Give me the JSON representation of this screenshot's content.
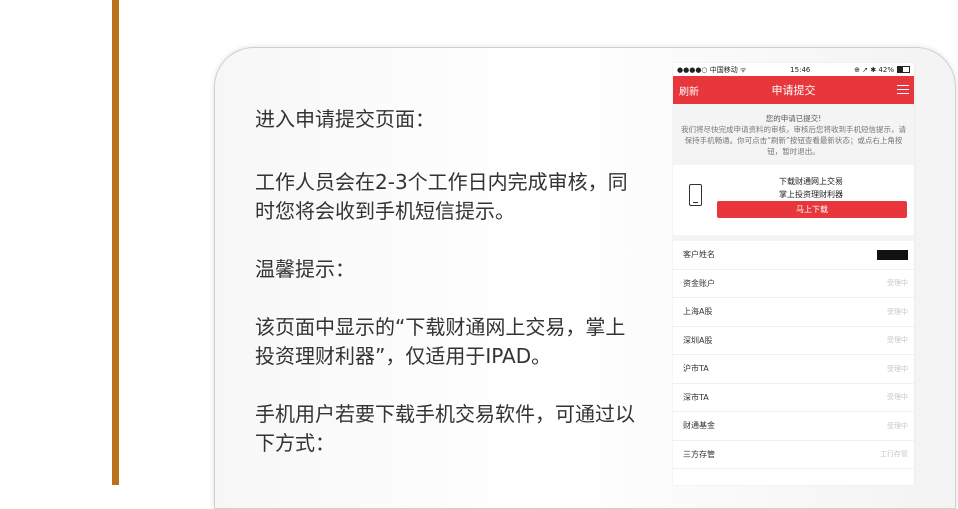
{
  "instructions": {
    "p1": "进入申请提交页面：",
    "p2": "工作人员会在2-3个工作日内完成审核，同时您将会收到手机短信提示。",
    "p3": "温馨提示：",
    "p4": "该页面中显示的“下载财通网上交易，掌上投资理财利器”，仅适用于IPAD。",
    "p5": "手机用户若要下载手机交易软件，可通过以下方式："
  },
  "phone": {
    "status": {
      "carrier": "●●●●○ 中国移动 ᯤ",
      "time": "15:46",
      "right": "⊕ ➚ ✱ 42%"
    },
    "nav": {
      "left": "刷新",
      "title": "申请提交",
      "menu_icon": "list-icon"
    },
    "notice": {
      "title": "您的申请已提交!",
      "body": "我们将尽快完成申请资料的审核，审核后您将收到手机短信提示，请保持手机畅通。你可点击“刷新”按钮查看最新状态；或点右上角按钮，暂时退出。"
    },
    "download": {
      "line1": "下载财通网上交易",
      "line2": "掌上投资理财利器",
      "button": "马上下载"
    },
    "rows": [
      {
        "label": "客户姓名",
        "value": ""
      },
      {
        "label": "资金账户",
        "value": "受理中"
      },
      {
        "label": "上海A股",
        "value": "受理中"
      },
      {
        "label": "深圳A股",
        "value": "受理中"
      },
      {
        "label": "沪市TA",
        "value": "受理中"
      },
      {
        "label": "深市TA",
        "value": "受理中"
      },
      {
        "label": "财通基金",
        "value": "受理中"
      },
      {
        "label": "三方存管",
        "value": "工行存管"
      }
    ]
  },
  "colors": {
    "accent_red": "#e7373c",
    "left_bar": "#b9721b"
  }
}
